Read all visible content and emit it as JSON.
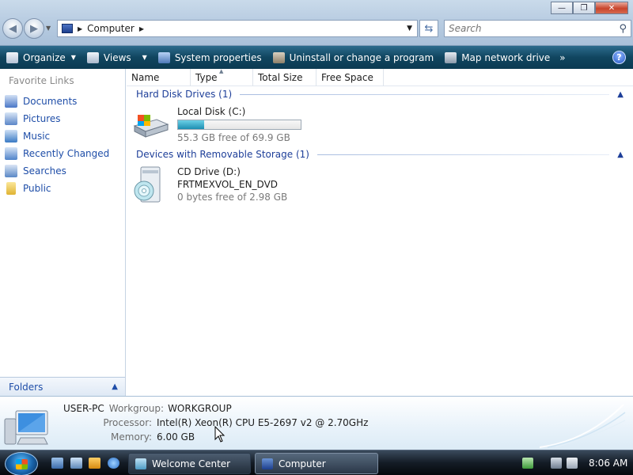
{
  "window": {
    "min_glyph": "—",
    "max_glyph": "❐",
    "close_glyph": "✕"
  },
  "address": {
    "path": "Computer",
    "search_placeholder": "Search"
  },
  "commands": [
    {
      "label": "Organize",
      "icon": "organize-icon",
      "has_dropdown": true
    },
    {
      "label": "Views",
      "icon": "views-icon",
      "has_dropdown": true
    },
    {
      "label": "System properties",
      "icon": "system-properties-icon"
    },
    {
      "label": "Uninstall or change a program",
      "icon": "uninstall-icon"
    },
    {
      "label": "Map network drive",
      "icon": "network-drive-icon"
    }
  ],
  "overflow": "»",
  "help_glyph": "?",
  "nav": {
    "title": "Favorite Links",
    "items": [
      {
        "label": "Documents",
        "icon": "documents-icon",
        "color": "#4a77c7"
      },
      {
        "label": "Pictures",
        "icon": "pictures-icon",
        "color": "#5b86c8"
      },
      {
        "label": "Music",
        "icon": "music-icon",
        "color": "#3a7ac4"
      },
      {
        "label": "Recently Changed",
        "icon": "recently-changed-icon",
        "color": "#4f83c9"
      },
      {
        "label": "Searches",
        "icon": "searches-icon",
        "color": "#5a88c6"
      },
      {
        "label": "Public",
        "icon": "public-folder-icon",
        "color": "#e8c04a"
      }
    ],
    "folders_label": "Folders"
  },
  "columns": [
    "Name",
    "Type",
    "Total Size",
    "Free Space"
  ],
  "groups": [
    {
      "title": "Hard Disk Drives (1)",
      "drives": [
        {
          "name": "Local Disk (C:)",
          "free_text": "55.3 GB free of 69.9 GB",
          "used_fraction": 0.21
        }
      ]
    },
    {
      "title": "Devices with Removable Storage (1)",
      "drives": [
        {
          "name": "CD Drive (D:)",
          "label": "FRTMEXVOL_EN_DVD",
          "free_text": "0 bytes free of 2.98 GB"
        }
      ]
    }
  ],
  "details": {
    "computer_name": "USER-PC",
    "workgroup_label": "Workgroup:",
    "workgroup": "WORKGROUP",
    "processor_label": "Processor:",
    "processor": "Intel(R) Xeon(R) CPU E5-2697 v2 @ 2.70GHz",
    "memory_label": "Memory:",
    "memory": "6.00 GB"
  },
  "taskbar": {
    "tasks": [
      {
        "label": "Welcome Center",
        "active": false
      },
      {
        "label": "Computer",
        "active": true
      }
    ],
    "clock": "8:06 AM"
  }
}
